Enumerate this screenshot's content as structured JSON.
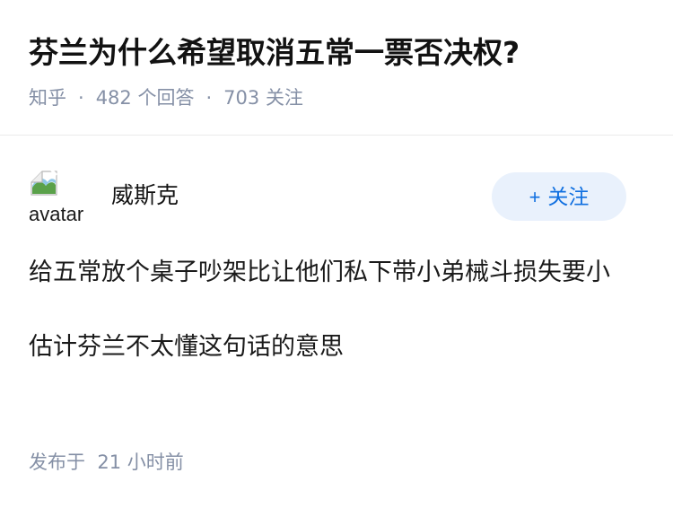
{
  "question": {
    "title": "芬兰为什么希望取消五常一票否决权?",
    "source": "知乎",
    "separator": "·",
    "answer_count": "482",
    "answer_label": "个回答",
    "follower_count": "703",
    "follower_label": "关注"
  },
  "answer": {
    "author": {
      "name": "威斯克",
      "avatar_alt": "avatar",
      "avatar_icon": "broken-image-icon"
    },
    "follow_button": {
      "plus": "+",
      "label": "关注"
    },
    "paragraphs": [
      "给五常放个桌子吵架比让他们私下带小弟械斗损失要小",
      "估计芬兰不太懂这句话的意思"
    ],
    "time_label": "发布于",
    "time_value": "21 小时前"
  },
  "colors": {
    "meta_gray": "#8590a6",
    "accent_blue": "#0f6fe0",
    "follow_bg": "#e9f1fc",
    "divider": "#ebebeb"
  }
}
